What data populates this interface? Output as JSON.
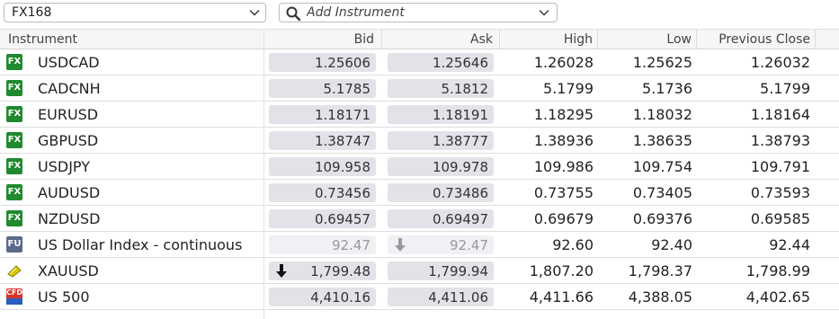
{
  "toolbar": {
    "list_name": "FX168",
    "search_placeholder": "Add Instrument"
  },
  "columns": {
    "instrument": "Instrument",
    "bid": "Bid",
    "ask": "Ask",
    "high": "High",
    "low": "Low",
    "prev": "Previous Close"
  },
  "colors": {
    "fx_badge": "#1f8a2f",
    "fu_badge": "#5a6a8c",
    "gold_badge": "#c9b400",
    "cfd_badge": "#d9322b",
    "cell_bg": "#e1e3e8"
  },
  "rows": [
    {
      "badge": "FX",
      "icon": "fx-icon",
      "name": "USDCAD",
      "bid": "1.25606",
      "ask": "1.25646",
      "high": "1.26028",
      "low": "1.25625",
      "prev": "1.26032"
    },
    {
      "badge": "FX",
      "icon": "fx-icon",
      "name": "CADCNH",
      "bid": "5.1785",
      "ask": "5.1812",
      "high": "5.1799",
      "low": "5.1736",
      "prev": "5.1799"
    },
    {
      "badge": "FX",
      "icon": "fx-icon",
      "name": "EURUSD",
      "bid": "1.18171",
      "ask": "1.18191",
      "high": "1.18295",
      "low": "1.18032",
      "prev": "1.18164"
    },
    {
      "badge": "FX",
      "icon": "fx-icon",
      "name": "GBPUSD",
      "bid": "1.38747",
      "ask": "1.38777",
      "high": "1.38936",
      "low": "1.38635",
      "prev": "1.38793"
    },
    {
      "badge": "FX",
      "icon": "fx-icon",
      "name": "USDJPY",
      "bid": "109.958",
      "ask": "109.978",
      "high": "109.986",
      "low": "109.754",
      "prev": "109.791"
    },
    {
      "badge": "FX",
      "icon": "fx-icon",
      "name": "AUDUSD",
      "bid": "0.73456",
      "ask": "0.73486",
      "high": "0.73755",
      "low": "0.73405",
      "prev": "0.73593"
    },
    {
      "badge": "FX",
      "icon": "fx-icon",
      "name": "NZDUSD",
      "bid": "0.69457",
      "ask": "0.69497",
      "high": "0.69679",
      "low": "0.69376",
      "prev": "0.69585"
    },
    {
      "badge": "FU",
      "icon": "futures-icon",
      "name": "US Dollar Index - continuous",
      "bid": "92.47",
      "ask": "92.47",
      "high": "92.60",
      "low": "92.40",
      "prev": "92.44"
    },
    {
      "badge": "",
      "icon": "gold-bar-icon",
      "name": "XAUUSD",
      "bid": "1,799.48",
      "ask": "1,799.94",
      "high": "1,807.20",
      "low": "1,798.37",
      "prev": "1,798.99"
    },
    {
      "badge": "CFD",
      "icon": "cfd-icon",
      "name": "US 500",
      "bid": "4,410.16",
      "ask": "4,411.06",
      "high": "4,411.66",
      "low": "4,388.05",
      "prev": "4,402.65"
    }
  ]
}
